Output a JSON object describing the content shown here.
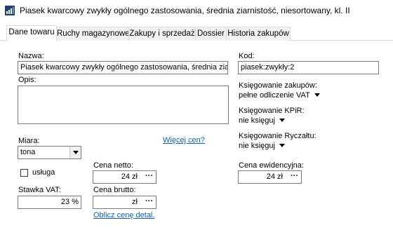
{
  "window": {
    "title": "Piasek kwarcowy zwykły ogólnego zastosowania, średnia ziarnistość, niesortowany, kl. II"
  },
  "tabs": [
    {
      "label": "Dane towaru",
      "active": true
    },
    {
      "label": "Ruchy magazynowe",
      "active": false
    },
    {
      "label": "Zakupy i sprzedaż",
      "active": false
    },
    {
      "label": "Dossier",
      "active": false
    },
    {
      "label": "Historia zakupów",
      "active": false
    }
  ],
  "form": {
    "name_label": "Nazwa:",
    "name_value": "Piasek kwarcowy zwykły ogólnego zastosowania, średnia ziarnistość, niesortowany, kl. II",
    "code_label": "Kod:",
    "code_value": "piasek:zwykły:2",
    "description_label": "Opis:",
    "description_value": "",
    "purchase_booking_label": "Księgowanie zakupów:",
    "purchase_booking_value": "pełne odliczenie VAT",
    "kpir_booking_label": "Księgowanie KPiR:",
    "kpir_booking_value": "nie księguj",
    "ryczalt_booking_label": "Księgowanie Ryczałtu:",
    "ryczalt_booking_value": "nie księguj",
    "unit_label": "Miara:",
    "unit_value": "tona",
    "more_prices_link": "Więcej cen?",
    "service_label": "usługa",
    "service_checked": false,
    "net_price_label": "Cena netto:",
    "net_price_value": "24 zł",
    "vat_rate_label": "Stawka VAT:",
    "vat_rate_value": "23 %",
    "gross_price_label": "Cena brutto:",
    "gross_price_value": "zł",
    "calc_retail_link": "Oblicz cenę detal.",
    "ledger_price_label": "Cena ewidencyjna:",
    "ledger_price_value": "24 zł",
    "dots": "···"
  },
  "colors": {
    "link": "#0f5fb5",
    "border": "#7a7a7a",
    "tab_bg": "#f2f2f2"
  }
}
